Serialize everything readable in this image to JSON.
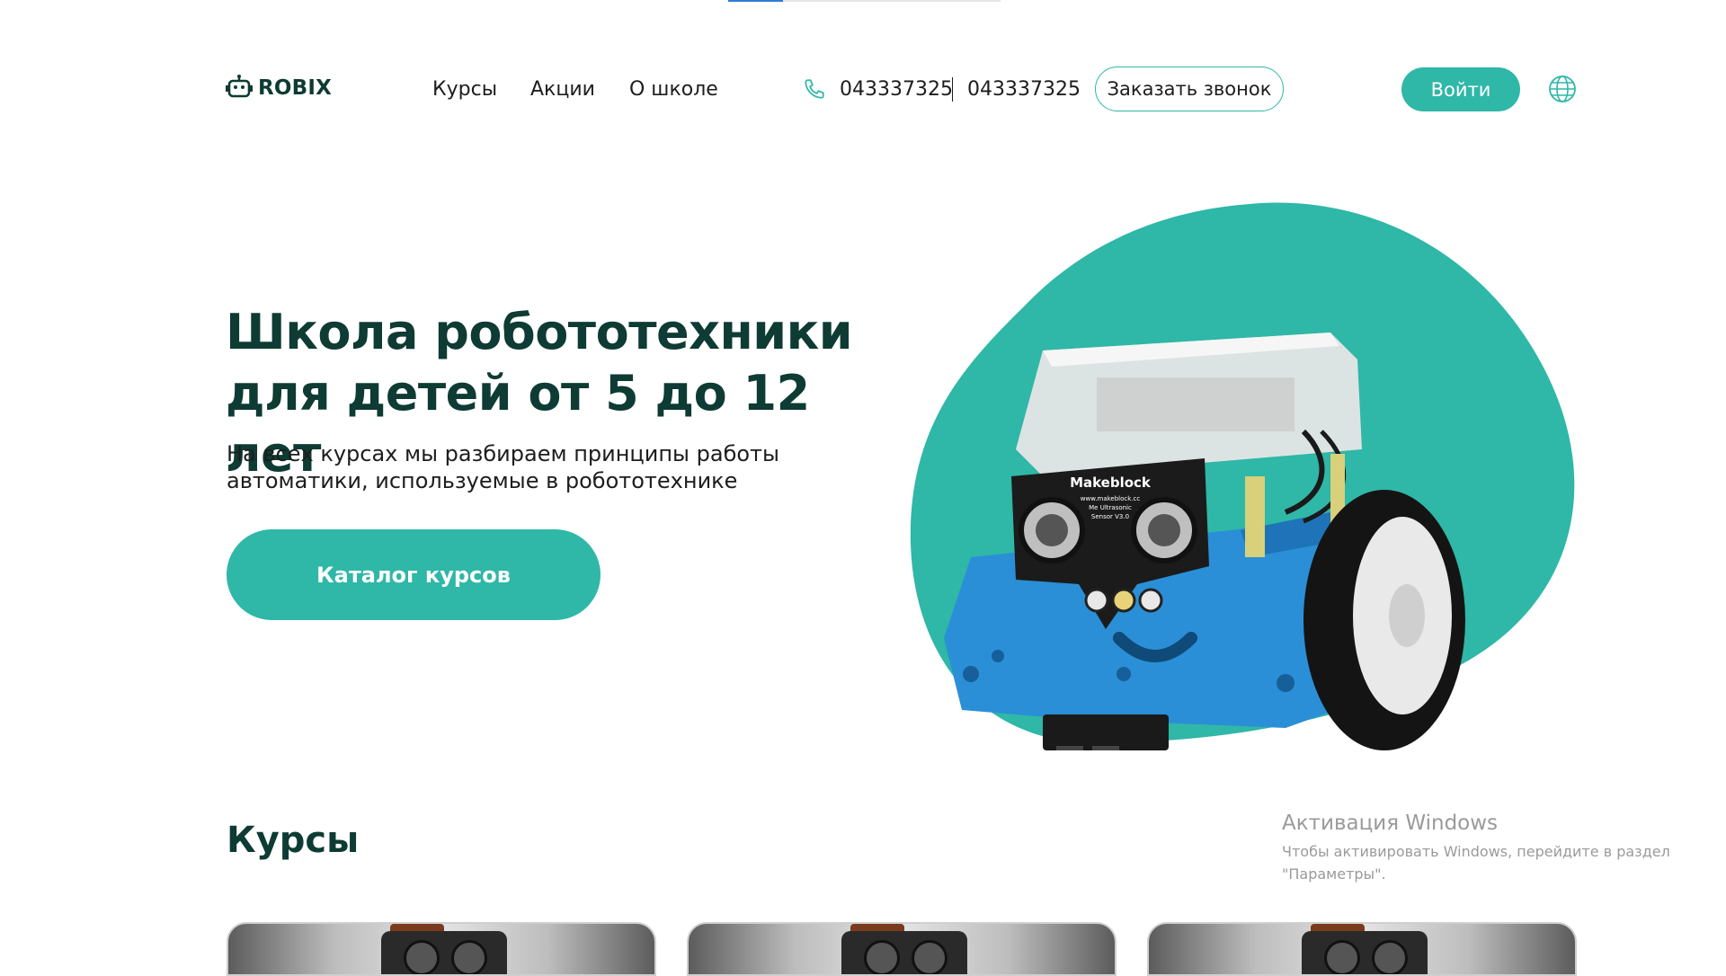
{
  "logo": {
    "text": "ROBIX",
    "icon": "robot-icon"
  },
  "nav": {
    "items": [
      {
        "label": "Курсы"
      },
      {
        "label": "Акции"
      },
      {
        "label": "О школе"
      }
    ]
  },
  "contacts": {
    "phone_icon": "phone-icon",
    "phone_1": "043337325",
    "phone_2": "043337325"
  },
  "header": {
    "call_button": "Заказать звонок",
    "login_button": "Войти",
    "language_icon": "globe-icon"
  },
  "hero": {
    "title_line1": "Школа робототехники",
    "title_line2": "для детей от 5 до 12 лет",
    "subtitle_line1": "На всех курсах мы разбираем принципы работы",
    "subtitle_line2": "автоматики, используемые в робототехнике",
    "cta": "Каталог курсов",
    "robot_label": "Makeblock",
    "robot_small_1": "www.makeblock.cc",
    "robot_small_2": "Me Ultrasonic",
    "robot_small_3": "Sensor V3.0"
  },
  "courses": {
    "title": "Курсы",
    "cards": [
      {},
      {},
      {}
    ]
  },
  "watermark": {
    "title": "Активация Windows",
    "line1": "Чтобы активировать Windows, перейдите в раздел",
    "line2": "\"Параметры\"."
  },
  "colors": {
    "accent": "#2fb7a7",
    "heading": "#0e3b33",
    "robot_blue": "#2a8fd6"
  }
}
